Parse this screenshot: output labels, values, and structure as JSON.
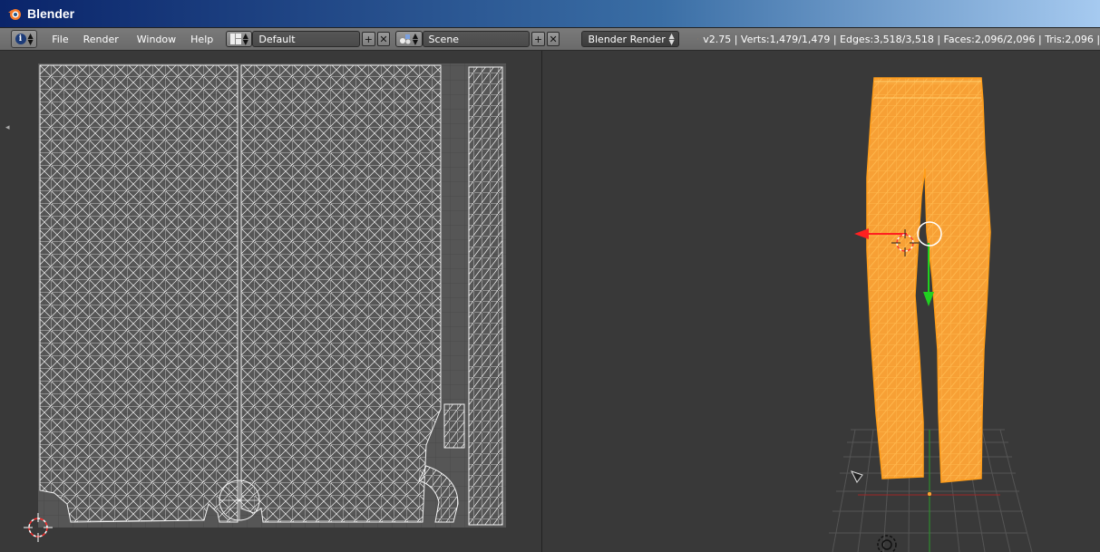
{
  "window": {
    "title": "Blender"
  },
  "menubar": {
    "menus": [
      "File",
      "Render",
      "Window",
      "Help"
    ],
    "layout": "Default",
    "scene": "Scene",
    "render_engine": "Blender Render",
    "stats": "v2.75 | Verts:1,479/1,479 | Edges:3,518/3,518 | Faces:2,096/2,096 | Tris:2,096 |"
  },
  "icons": {
    "info": "info-icon",
    "layout": "screen-layout-icon",
    "scene": "scene-icon",
    "blender": "blender-logo-icon",
    "add": "plus-icon",
    "remove": "x-icon"
  },
  "colors": {
    "mesh_orange": "#f7a035",
    "wire_white": "#ffffff",
    "manip_red": "#ff2020",
    "manip_green": "#20d020",
    "title_bar": "#0a246a"
  }
}
